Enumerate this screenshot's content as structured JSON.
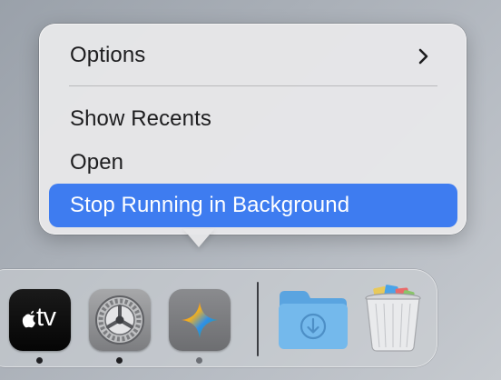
{
  "context_menu": {
    "items": [
      {
        "label": "Options",
        "has_submenu": true,
        "icon": "chevron-right-icon"
      },
      {
        "label": "Show Recents"
      },
      {
        "label": "Open"
      },
      {
        "label": "Stop Running in Background",
        "highlighted": true
      }
    ],
    "highlight_color": "#3e7cf0"
  },
  "dock": {
    "apps": [
      {
        "name": "Apple TV",
        "icon": "apple-tv-icon",
        "text": "tv",
        "running": true
      },
      {
        "name": "System Settings",
        "icon": "system-settings-icon",
        "running": true
      },
      {
        "name": "Gemini",
        "icon": "sparkle-icon",
        "running": true
      }
    ],
    "stacks": [
      {
        "name": "Downloads",
        "icon": "downloads-folder-icon"
      },
      {
        "name": "Trash",
        "icon": "trash-icon"
      }
    ]
  }
}
